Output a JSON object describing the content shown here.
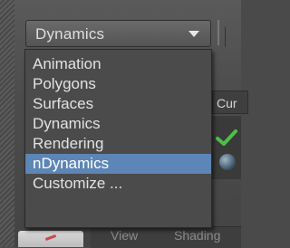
{
  "menu_selector": {
    "value": "Dynamics",
    "arrow_icon": "triangle-down-icon"
  },
  "dropdown": {
    "items": [
      {
        "label": "Animation",
        "selected": false
      },
      {
        "label": "Polygons",
        "selected": false
      },
      {
        "label": "Surfaces",
        "selected": false
      },
      {
        "label": "Dynamics",
        "selected": false
      },
      {
        "label": "Rendering",
        "selected": false
      },
      {
        "label": "nDynamics",
        "selected": true
      },
      {
        "label": "Customize ...",
        "selected": false
      }
    ]
  },
  "background": {
    "tab_label": "Cur",
    "view_bar": {
      "view_label": "View",
      "shading_label": "Shading"
    }
  },
  "colors": {
    "highlight": "#5d85b6",
    "menu_bg": "#4b4b4b",
    "text": "#e2e2e2"
  }
}
